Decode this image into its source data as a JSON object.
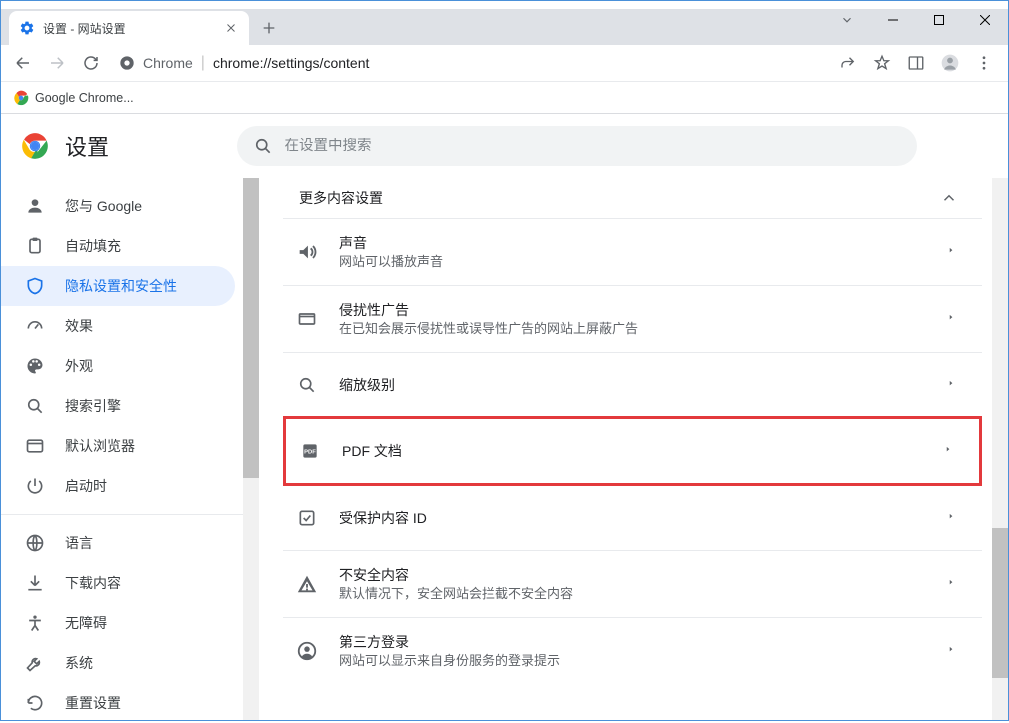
{
  "window": {
    "tab_title": "设置 - 网站设置",
    "bookmark_label": "Google Chrome..."
  },
  "addressbar": {
    "chrome_label": "Chrome",
    "url": "chrome://settings/content"
  },
  "header": {
    "title": "设置",
    "search_placeholder": "在设置中搜索"
  },
  "sidebar": {
    "items": [
      {
        "label": "您与 Google"
      },
      {
        "label": "自动填充"
      },
      {
        "label": "隐私设置和安全性"
      },
      {
        "label": "效果"
      },
      {
        "label": "外观"
      },
      {
        "label": "搜索引擎"
      },
      {
        "label": "默认浏览器"
      },
      {
        "label": "启动时"
      }
    ],
    "items2": [
      {
        "label": "语言"
      },
      {
        "label": "下载内容"
      },
      {
        "label": "无障碍"
      },
      {
        "label": "系统"
      },
      {
        "label": "重置设置"
      }
    ]
  },
  "content": {
    "section_title": "更多内容设置",
    "rows": [
      {
        "title": "声音",
        "desc": "网站可以播放声音"
      },
      {
        "title": "侵扰性广告",
        "desc": "在已知会展示侵扰性或误导性广告的网站上屏蔽广告"
      },
      {
        "title": "缩放级别",
        "desc": ""
      },
      {
        "title": "PDF 文档",
        "desc": ""
      },
      {
        "title": "受保护内容 ID",
        "desc": ""
      },
      {
        "title": "不安全内容",
        "desc": "默认情况下，安全网站会拦截不安全内容"
      },
      {
        "title": "第三方登录",
        "desc": "网站可以显示来自身份服务的登录提示"
      }
    ]
  }
}
